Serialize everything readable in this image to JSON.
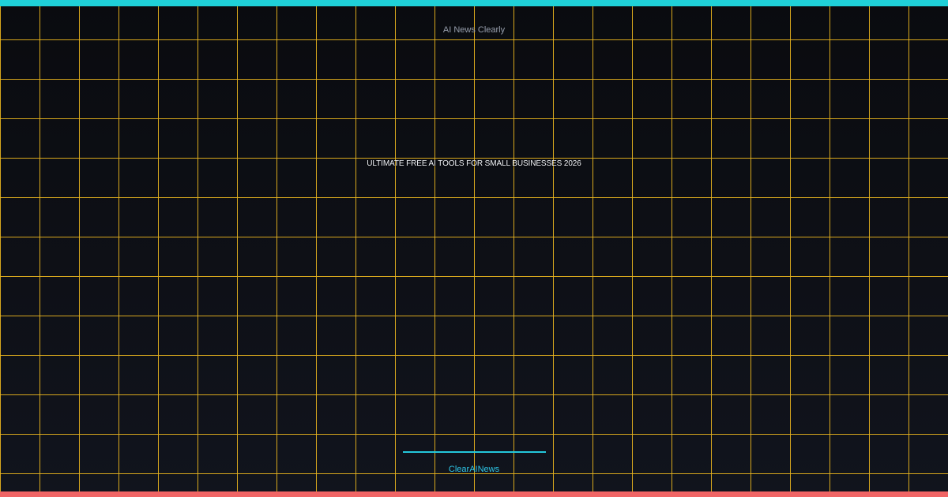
{
  "site_name": "AI News Clearly",
  "headline": "ULTIMATE FREE AI TOOLS FOR SMALL BUSINESSES 2026",
  "brand": "ClearAINews",
  "colors": {
    "background": "#0c0d12",
    "grid": "#e8b41e",
    "top_bar": "#1fd0d8",
    "bottom_bar": "#f06565",
    "accent": "#24c7db",
    "headline": "#f2f4f8",
    "site_name": "#98a0ae"
  }
}
